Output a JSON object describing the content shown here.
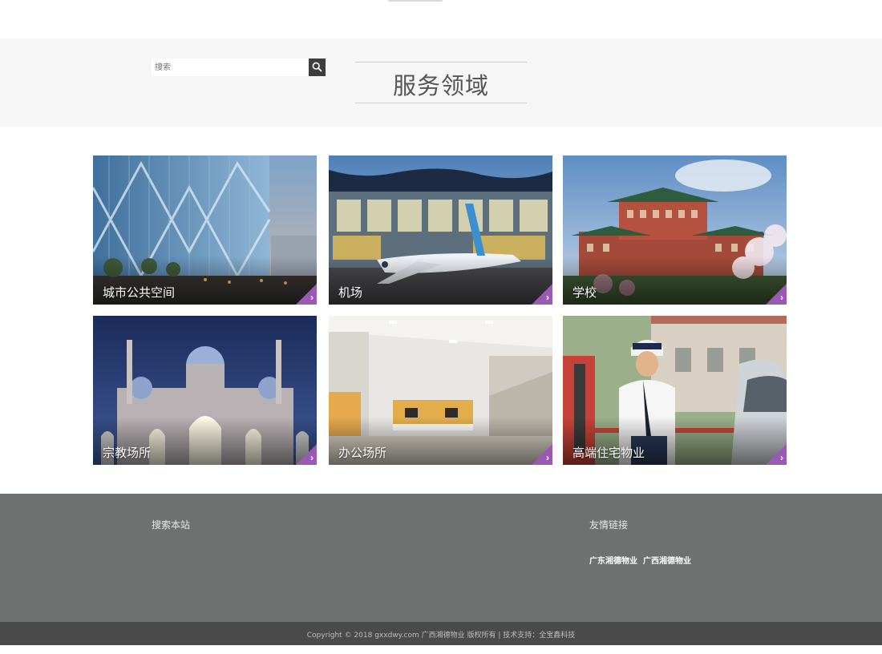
{
  "section": {
    "title": "服务领域"
  },
  "cards": [
    {
      "label": "城市公共空间",
      "image": "city-public-space-photo"
    },
    {
      "label": "机场",
      "image": "airport-photo"
    },
    {
      "label": "学校",
      "image": "school-photo"
    },
    {
      "label": "宗教场所",
      "image": "religious-site-photo"
    },
    {
      "label": "办公场所",
      "image": "office-photo"
    },
    {
      "label": "高端住宅物业",
      "image": "residential-property-photo"
    }
  ],
  "footer": {
    "search_title": "搜索本站",
    "search_placeholder": "搜索",
    "links_title": "友情链接",
    "links": [
      "广东湘德物业",
      "广西湘德物业"
    ]
  },
  "copyright": "Copyright © 2018 gxxdwy.com 广西湘德物业 版权所有 | 技术支持：全宝鑫科技",
  "colors": {
    "accent": "#9b59b6",
    "footer_bg": "#6f7070",
    "copyright_bg": "#4a4a4a",
    "section_bg": "#f6f6f6"
  },
  "icons": {
    "card_corner": "chevron-right-icon",
    "search_button": "search-icon"
  }
}
